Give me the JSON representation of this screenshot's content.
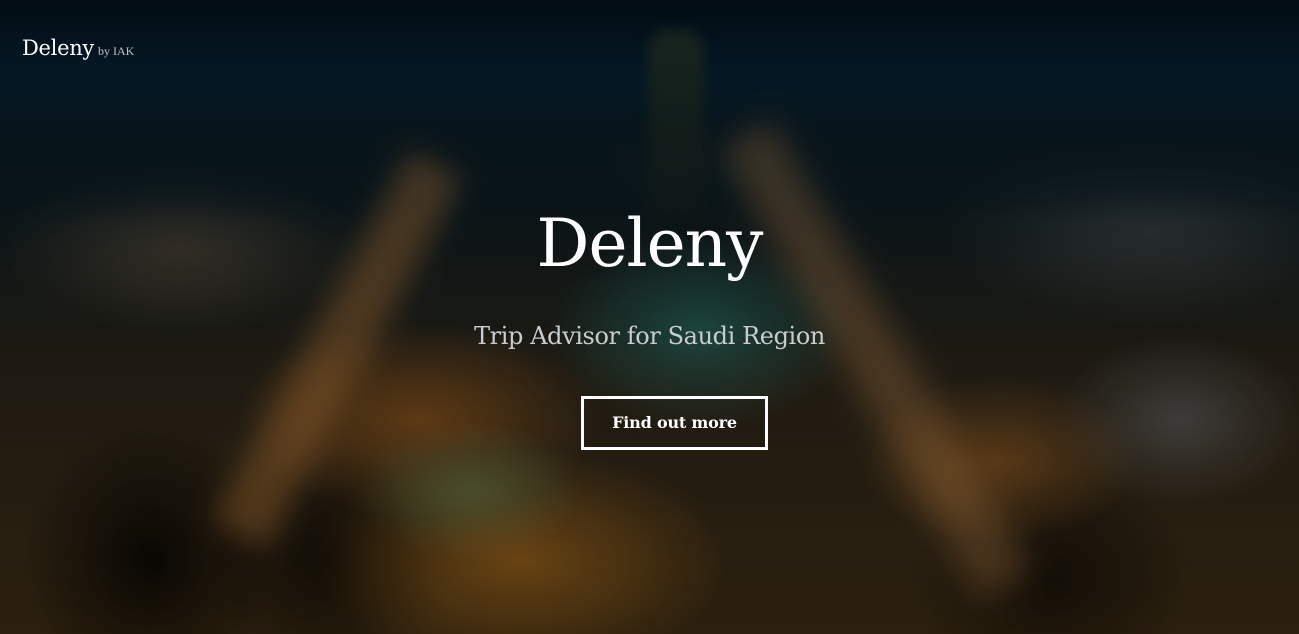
{
  "navbar": {
    "brand": "Deleny",
    "brand_suffix": "by IAK"
  },
  "hero": {
    "title": "Deleny",
    "subtitle": "Trip Advisor for Saudi Region",
    "cta_label": "Find out more",
    "background": "blurred-night-city-photo"
  },
  "colors": {
    "text": "#ffffff",
    "subtitle": "#c9ccce",
    "button_border": "#ffffff"
  }
}
